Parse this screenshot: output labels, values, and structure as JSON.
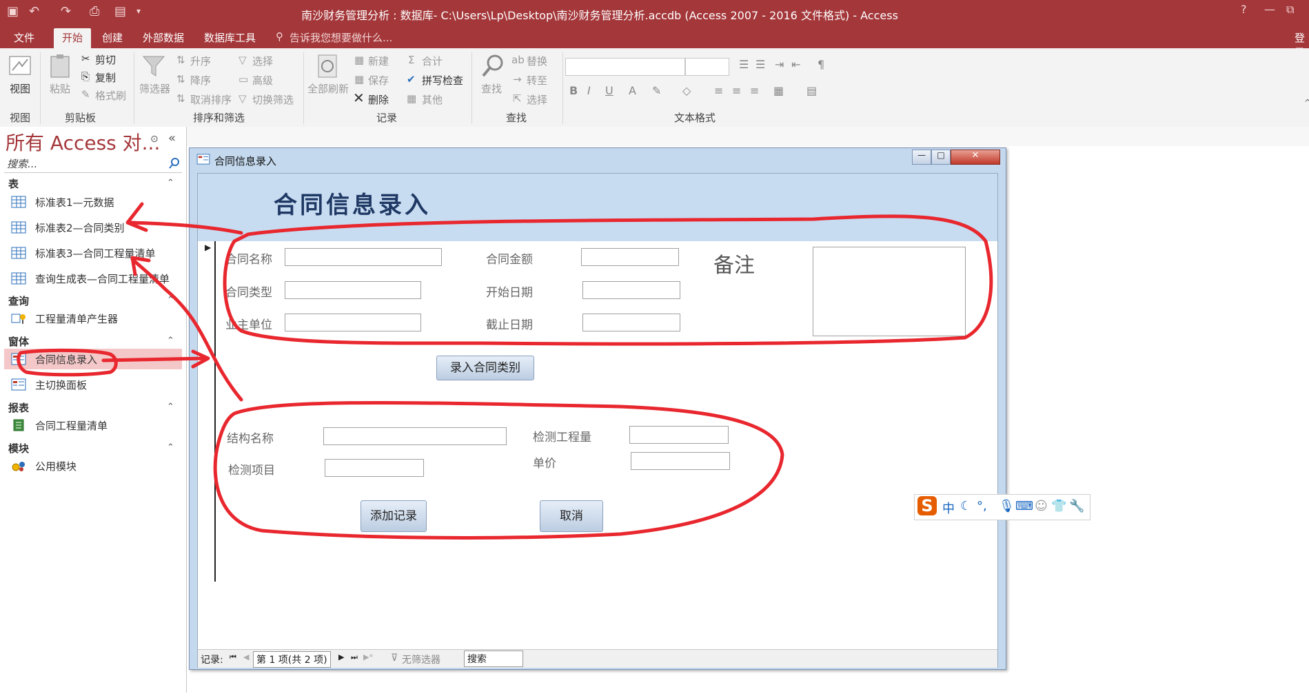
{
  "titlebar": {
    "title": "南沙财务管理分析 : 数据库- C:\\Users\\Lp\\Desktop\\南沙财务管理分析.accdb (Access 2007 - 2016 文件格式) - Access",
    "help": "?",
    "minimize": "—",
    "restore": "⧉"
  },
  "tabs": {
    "file": "文件",
    "home": "开始",
    "create": "创建",
    "external": "外部数据",
    "dbtools": "数据库工具",
    "tellme": "告诉我您想要做什么...",
    "login": "登录"
  },
  "ribbon": {
    "view": {
      "label": "视图",
      "group": "视图"
    },
    "clipboard": {
      "paste": "粘贴",
      "cut": "剪切",
      "copy": "复制",
      "format_painter": "格式刷",
      "group": "剪贴板"
    },
    "sortfilter": {
      "filter": "筛选器",
      "asc": "升序",
      "desc": "降序",
      "remove_sort": "取消排序",
      "selection": "选择",
      "advanced": "高级",
      "toggle": "切换筛选",
      "group": "排序和筛选"
    },
    "records": {
      "refresh": "全部刷新",
      "new": "新建",
      "save": "保存",
      "delete": "删除",
      "totals": "合计",
      "spelling": "拼写检查",
      "more": "其他",
      "group": "记录"
    },
    "find": {
      "find": "查找",
      "replace": "替换",
      "goto": "转至",
      "select": "选择",
      "group": "查找"
    },
    "textformat": {
      "bold": "B",
      "italic": "I",
      "underline": "U",
      "group": "文本格式"
    }
  },
  "nav": {
    "title": "所有 Access 对...",
    "search_placeholder": "搜索...",
    "sections": {
      "tables": "表",
      "queries": "查询",
      "forms": "窗体",
      "reports": "报表",
      "modules": "模块"
    },
    "tables": [
      "标准表1—元数据",
      "标准表2—合同类别",
      "标准表3—合同工程量清单",
      "查询生成表—合同工程量清单"
    ],
    "queries": [
      "工程量清单产生器"
    ],
    "forms": [
      "合同信息录入",
      "主切换面板"
    ],
    "reports": [
      "合同工程量清单"
    ],
    "modules": [
      "公用模块"
    ]
  },
  "form": {
    "window_title": "合同信息录入",
    "header": "合同信息录入",
    "labels": {
      "contract_name": "合同名称",
      "contract_amount": "合同金额",
      "remark": "备注",
      "contract_type": "合同类型",
      "start_date": "开始日期",
      "owner": "业主单位",
      "end_date": "截止日期",
      "structure_name": "结构名称",
      "test_quantity": "检测工程量",
      "test_item": "检测项目",
      "unit_price": "单价"
    },
    "buttons": {
      "enter_type": "录入合同类别",
      "add_record": "添加记录",
      "cancel": "取消"
    },
    "recbar": {
      "label": "记录:",
      "position": "第 1 项(共 2 项)",
      "filter": "无筛选器",
      "search": "搜索"
    }
  },
  "ime": {
    "mode": "中"
  },
  "colors": {
    "accent": "#a4373a",
    "annotation": "#e8272e",
    "form_header": "#c7dcf1"
  }
}
